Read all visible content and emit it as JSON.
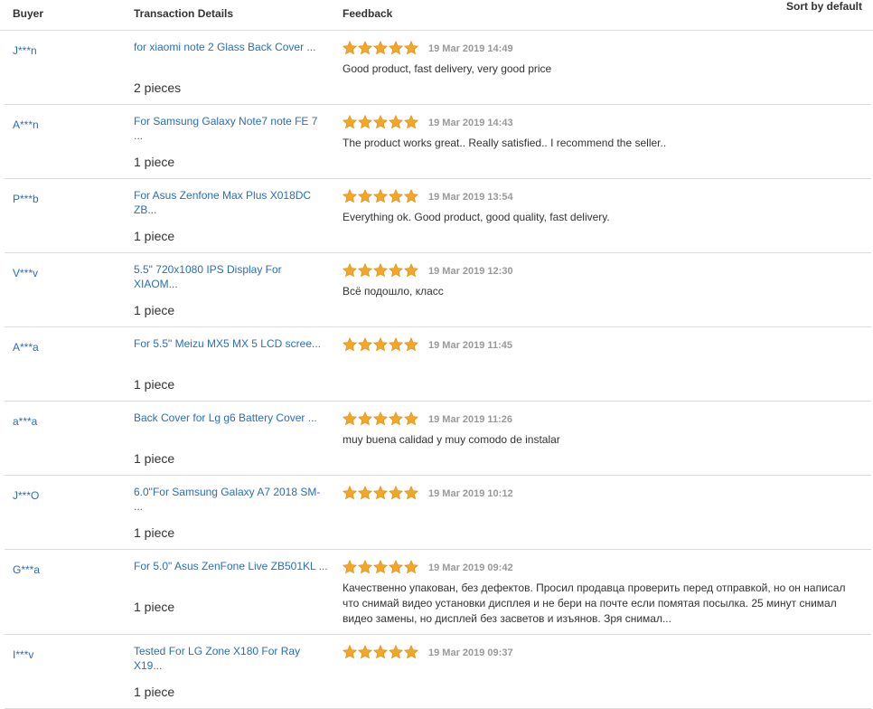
{
  "header": {
    "buyer": "Buyer",
    "transaction": "Transaction Details",
    "feedback": "Feedback",
    "sort": "Sort by default"
  },
  "colors": {
    "link": "#2a6eb8",
    "star": "#f5a623",
    "date": "#999999"
  },
  "rows": [
    {
      "buyer": "J***n",
      "title": "for xiaomi note 2 Glass Back Cover ...",
      "qty": "2 pieces",
      "rating": 5,
      "date": "19 Mar 2019 14:49",
      "feedback": "Good product, fast delivery, very good price"
    },
    {
      "buyer": "A***n",
      "title": "For Samsung Galaxy Note7 note FE 7 ...",
      "qty": "1 piece",
      "rating": 5,
      "date": "19 Mar 2019 14:43",
      "feedback": "The product works great.. Really satisfied.. I recommend the seller.."
    },
    {
      "buyer": "P***b",
      "title": "For Asus Zenfone Max Plus X018DC ZB...",
      "qty": "1 piece",
      "rating": 5,
      "date": "19 Mar 2019 13:54",
      "feedback": "Everything ok. Good product, good quality, fast delivery."
    },
    {
      "buyer": "V***v",
      "title": "5.5\" 720x1080 IPS Display For XIAOM...",
      "qty": "1 piece",
      "rating": 5,
      "date": "19 Mar 2019 12:30",
      "feedback": "Всё подошло, класс"
    },
    {
      "buyer": "A***a",
      "title": "For 5.5\" Meizu MX5 MX 5 LCD scree...",
      "qty": "1 piece",
      "rating": 5,
      "date": "19 Mar 2019 11:45",
      "feedback": ""
    },
    {
      "buyer": "a***a",
      "title": "Back Cover for Lg g6 Battery Cover ...",
      "qty": "1 piece",
      "rating": 5,
      "date": "19 Mar 2019 11:26",
      "feedback": "muy buena calidad y muy comodo de instalar"
    },
    {
      "buyer": "J***O",
      "title": "6.0\"For Samsung Galaxy A7 2018 SM- ...",
      "qty": "1 piece",
      "rating": 5,
      "date": "19 Mar 2019 10:12",
      "feedback": ""
    },
    {
      "buyer": "G***a",
      "title": "For 5.0\" Asus ZenFone Live ZB501KL ...",
      "qty": "1 piece",
      "rating": 5,
      "date": "19 Mar 2019 09:42",
      "feedback": "Качественно упакован, без дефектов. Просил продавца проверить перед отправкой, но он написал что снимай видео установки дисплея и не бери на почте если помятая посылка. 25 минут снимал видео замены, но дисплей без засветов и изъянов. Зря снимал..."
    },
    {
      "buyer": "I***v",
      "title": "Tested For LG Zone X180 For Ray X19...",
      "qty": "1 piece",
      "rating": 5,
      "date": "19 Mar 2019 09:37",
      "feedback": ""
    }
  ]
}
